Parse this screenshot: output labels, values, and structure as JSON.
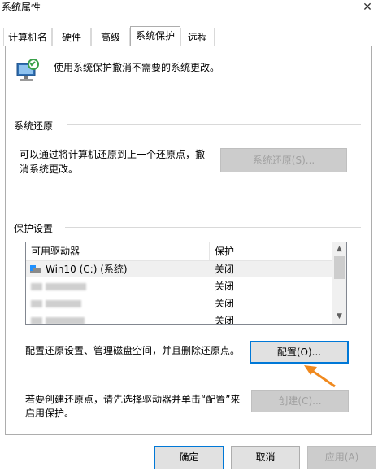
{
  "window": {
    "title": "系统属性"
  },
  "tabs": [
    {
      "label": "计算机名"
    },
    {
      "label": "硬件"
    },
    {
      "label": "高级"
    },
    {
      "label": "系统保护"
    },
    {
      "label": "远程"
    }
  ],
  "active_tab": "系统保护",
  "intro": {
    "text": "使用系统保护撤消不需要的系统更改。",
    "icon": "system-protection-icon"
  },
  "system_restore": {
    "heading": "系统还原",
    "description_line1": "可以通过将计算机还原到上一个还原点，撤",
    "description_line2": "消系统更改。",
    "button_label": "系统还原(S)..."
  },
  "protection_settings": {
    "heading": "保护设置",
    "columns": [
      "可用驱动器",
      "保护"
    ],
    "rows": [
      {
        "drive": "Win10 (C:) (系统)",
        "protection": "关闭"
      },
      {
        "drive": "",
        "protection": "关闭"
      },
      {
        "drive": "",
        "protection": "关闭"
      },
      {
        "drive": "",
        "protection": "关闭"
      }
    ]
  },
  "configure": {
    "text": "配置还原设置、管理磁盘空间，并且删除还原点。",
    "button_label": "配置(O)..."
  },
  "create": {
    "text_line1": "若要创建还原点，请先选择驱动器并单击“配置”来",
    "text_line2": "启用保护。",
    "button_label": "创建(C)..."
  },
  "footer": {
    "ok_label": "确定",
    "cancel_label": "取消",
    "apply_label": "应用(A)"
  },
  "colors": {
    "focus_border": "#0078d7",
    "arrow": "#f0891e",
    "disabled_text": "#a0a0a0"
  }
}
